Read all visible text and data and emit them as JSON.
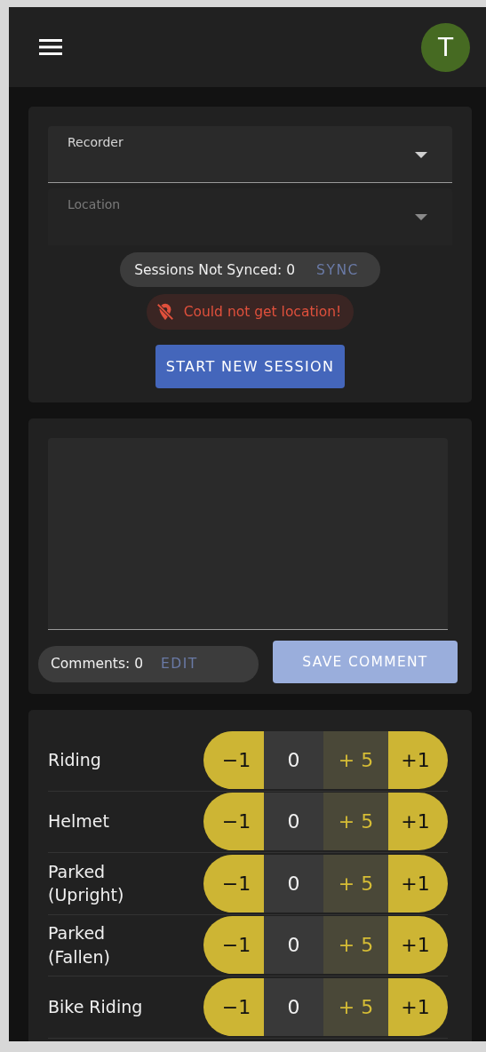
{
  "app_bar": {
    "avatar": "T"
  },
  "session_card": {
    "fields": [
      {
        "label": "Recorder",
        "disabled": false
      },
      {
        "label": "Location",
        "disabled": true
      }
    ],
    "sync": {
      "text": "Sessions Not Synced: 0",
      "button": "SYNC",
      "disabled": true
    },
    "error": {
      "text": "Could not get location!"
    },
    "start_button": {
      "label": "START NEW SESSION",
      "disabled": false
    }
  },
  "comment_card": {
    "comments": {
      "text": "Comments: 0",
      "button": "EDIT",
      "disabled": true
    },
    "save_button": {
      "label": "SAVE COMMENT",
      "disabled": true
    }
  },
  "counters": [
    {
      "label": "Riding",
      "minus": "−1",
      "count": "0",
      "plus_five": "+ 5",
      "plus_one": "+1"
    },
    {
      "label": "Helmet",
      "minus": "−1",
      "count": "0",
      "plus_five": "+ 5",
      "plus_one": "+1"
    },
    {
      "label": "Parked (Upright)",
      "minus": "−1",
      "count": "0",
      "plus_five": "+ 5",
      "plus_one": "+1"
    },
    {
      "label": "Parked (Fallen)",
      "minus": "−1",
      "count": "0",
      "plus_five": "+ 5",
      "plus_one": "+1"
    },
    {
      "label": "Bike Riding",
      "minus": "−1",
      "count": "0",
      "plus_five": "+ 5",
      "plus_one": "+1"
    }
  ]
}
